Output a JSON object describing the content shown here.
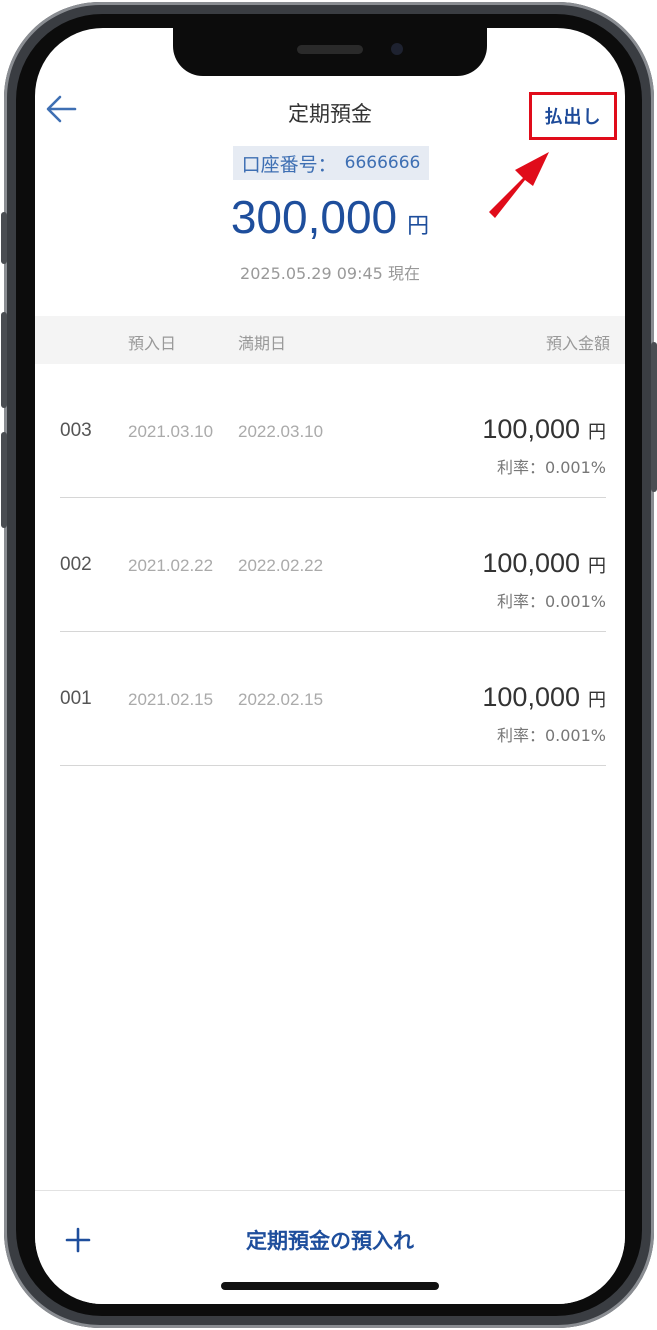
{
  "header": {
    "title": "定期預金",
    "withdraw_label": "払出し"
  },
  "account": {
    "label": "口座番号：",
    "number": "6666666"
  },
  "summary": {
    "total_amount": "300,000",
    "unit": "円",
    "as_of": "2025.05.29 09:45 現在"
  },
  "table": {
    "col_deposit_date": "預入日",
    "col_maturity_date": "満期日",
    "col_amount": "預入金額",
    "rows": [
      {
        "no": "003",
        "deposit_date": "2021.03.10",
        "maturity_date": "2022.03.10",
        "amount": "100,000",
        "unit": "円",
        "rate": "利率：0.001%"
      },
      {
        "no": "002",
        "deposit_date": "2021.02.22",
        "maturity_date": "2022.02.22",
        "amount": "100,000",
        "unit": "円",
        "rate": "利率：0.001%"
      },
      {
        "no": "001",
        "deposit_date": "2021.02.15",
        "maturity_date": "2022.02.15",
        "amount": "100,000",
        "unit": "円",
        "rate": "利率：0.001%"
      }
    ]
  },
  "footer": {
    "deposit_button_label": "定期預金の預入れ"
  },
  "icons": {
    "back": "back-arrow-icon",
    "plus": "plus-icon",
    "annotation": "red-arrow-icon"
  },
  "colors": {
    "accent_blue": "#1e4e9c",
    "highlight_red": "#e00c1a",
    "badge_bg": "#e6ebf3"
  }
}
